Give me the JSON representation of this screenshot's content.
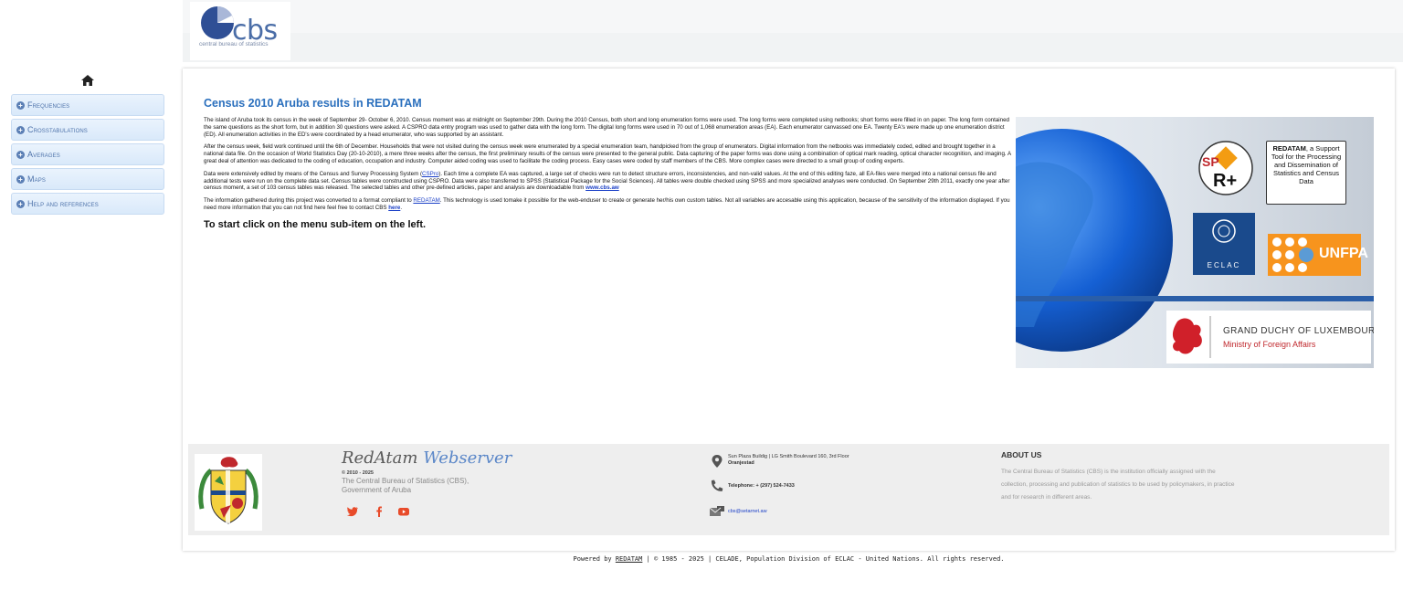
{
  "header": {
    "logo_word": "cbs",
    "logo_sub": "central bureau of statistics"
  },
  "sidebar": {
    "home_icon": "home-icon",
    "items": [
      {
        "label": "Frequencies"
      },
      {
        "label": "Crosstabulations"
      },
      {
        "label": "Averages"
      },
      {
        "label": "Maps"
      },
      {
        "label": "Help and references"
      }
    ]
  },
  "main": {
    "title": "Census 2010 Aruba results in REDATAM",
    "p1": "The island of Aruba took its census in the week of September 29- October 6, 2010. Census moment was at midnight on September 29th. During the 2010 Census, both short and long enumeration forms were used. The long forms were completed using netbooks; short forms were filled in on paper. The long form contained the same questions as the short form, but in addition 30 questions were asked. A CSPRO data entry program was used to gather data with the long form. The digital long forms were used in 70 out of 1,068 enumeration areas (EA). Each enumerator canvassed one EA. Twenty EA's were made up one enumeration district (ED). All enumeration activities in the ED's were coordinated by a head enumerator, who was supported by an assistant.",
    "p2": "After the census week, field work continued until the 6th of December. Households that were not visited during the census week were enumerated by a special enumeration team, handpicked from the group of enumerators. Digital information from the netbooks was immediately coded, edited and brought together in a national data file. On the occasion of World Statistics Day (20-10-2010), a mere three weeks after the census, the first preliminary results of the census were presented to the general public. Data capturing of the paper forms was done using a combination of optical mark reading, optical character recognition, and imaging. A great deal of attention was dedicated to the coding of education, occupation and industry. Computer aided coding was used to facilitate the coding process. Easy cases were coded by staff members of the CBS. More complex cases were directed to a small group of coding experts.",
    "p3a": "Data were extensively edited by means of the Census and Survey Processing System (",
    "p3_link": "CSPro",
    "p3b": "). Each time a complete EA was captured, a large set of checks were run to detect structure errors, inconsistencies, and non-valid values. At the end of this editing faze, all EA-files were merged into a national census file and additional tests were run on the complete data set. Census tables were constructed using CSPRO. Data were also transferred to SPSS (Statistical Package for the Social Sciences). All tables were double checked using SPSS and more specialized analyses were conducted. On September 29th 2011, exactly one year after census moment, a set of 103 census tables was released. The selected tables and other pre-defined articles, paper and analysis are downloadable from ",
    "p3_link2": "www.cbs.aw",
    "p4a": "The information gathered during this project was converted to a format compliant to ",
    "p4_link": "REDATAM",
    "p4b": ". This technology is used tomake it possible for the web-enduser to create or generate her/his own custom tables. Not all variables are accesable using this application, because of the sensitivity of the information displayed. If you need more information that you can not find here feel free to contact CBS ",
    "p4_link2": "here",
    "p4c": ".",
    "start": "To start click on the menu sub-item on the left."
  },
  "hero": {
    "redatam_bold": "REDATAM",
    "redatam_rest": ", a Support Tool for the Processing and Dissemination of Statistics and Census Data",
    "eclac": "ECLAC",
    "unfpa": "UNFPA",
    "lux1": "GRAND DUCHY OF LUXEMBOURG",
    "lux2": "Ministry of Foreign Affairs"
  },
  "footer": {
    "brand1": "RedAtam",
    "brand2": "Webserver",
    "copy": "© 2010 - 2025",
    "org1": "The Central Bureau of Statistics (CBS),",
    "org2": "Government of Aruba",
    "address1": "Sun Plaza Buildig | LG Smith Boulevard 160, 3rd Floor",
    "address2": "Oranjestad",
    "phone": "Telephone: + (297) 524-7433",
    "email": "cbs@setarnet.aw",
    "about_heading": "ABOUT US",
    "about_text": "The Central Bureau of Statistics (CBS) is the institution officially assigned with the collection, processing and publication of statistics to be used by policymakers, in practice and for research in different areas.",
    "social": [
      "twitter-icon",
      "facebook-icon",
      "youtube-icon"
    ],
    "accent": "#e84b2a"
  },
  "powered": {
    "a": "Powered by ",
    "link": "REDATAM",
    "b": " | © 1985 - 2025 | CELADE, Population Division of ECLAC - United Nations. All rights reserved."
  }
}
